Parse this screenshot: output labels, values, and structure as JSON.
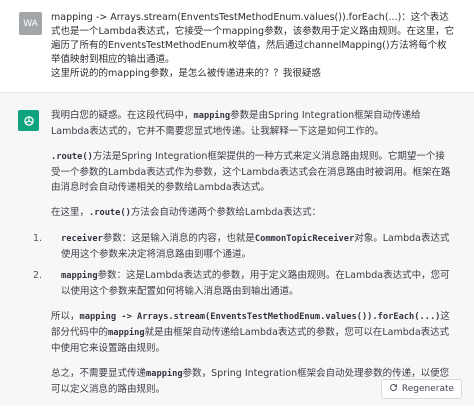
{
  "user": {
    "avatar": "WA",
    "lines": [
      "mapping -> Arrays.stream(EnventsTestMethodEnum.values()).forEach(...)：这个表达式也是一个Lambda表达式，它接受一个mapping参数，该参数用于定义路由规则。在这里，它遍历了所有的EnventsTestMethodEnum枚举值，然后通过channelMapping()方法将每个枚举值映射到相应的输出通道。",
      "这里所说的的mapping参数，是怎么被传递进来的？？我很疑惑"
    ]
  },
  "assistant": {
    "avatar_icon": "openai-logo-icon",
    "p1": "我明白您的疑惑。在这段代码中，`mapping`参数是由Spring Integration框架自动传递给Lambda表达式的，它并不需要您显式地传递。让我解释一下这是如何工作的。",
    "p2_code": ".route()",
    "p2_text": "方法是Spring Integration框架提供的一种方式来定义消息路由规则。它期望一个接受一个参数的Lambda表达式作为参数，这个Lambda表达式会在消息路由时被调用。框架在路由消息时会自动传递相关的参数给Lambda表达式。",
    "p3_pre": "在这里，",
    "p3_code": ".route()",
    "p3_post": "方法会自动传递两个参数给Lambda表达式：",
    "list": [
      {
        "num": "1.",
        "code": "receiver",
        "pre": "参数：这是输入消息的内容，也就是",
        "code2": "CommonTopicReceiver",
        "post": "对象。Lambda表达式使用这个参数来决定将消息路由到哪个通道。"
      },
      {
        "num": "2.",
        "code": "mapping",
        "pre": "参数：这是Lambda表达式的参数，用于定义路由规则。在Lambda表达式中，您可以使用这个参数来配置如何将输入消息路由到输出通道。",
        "code2": "",
        "post": ""
      }
    ],
    "p4_pre": "所以，",
    "p4_code": "mapping -> Arrays.stream(EnventsTestMethodEnum.values()).forEach(...)",
    "p4_mid": "这部分代码中的",
    "p4_code2": "mapping",
    "p4_post": "就是由框架自动传递给Lambda表达式的参数，您可以在Lambda表达式中使用它来设置路由规则。",
    "p5_pre": "总之，不需要显式传递",
    "p5_code": "mapping",
    "p5_post": "参数，Spring Integration框架会自动处理参数的传递，以便您可以定义消息的路由规则。"
  },
  "regenerate": {
    "label": "Regenerate",
    "icon": "refresh-icon"
  }
}
